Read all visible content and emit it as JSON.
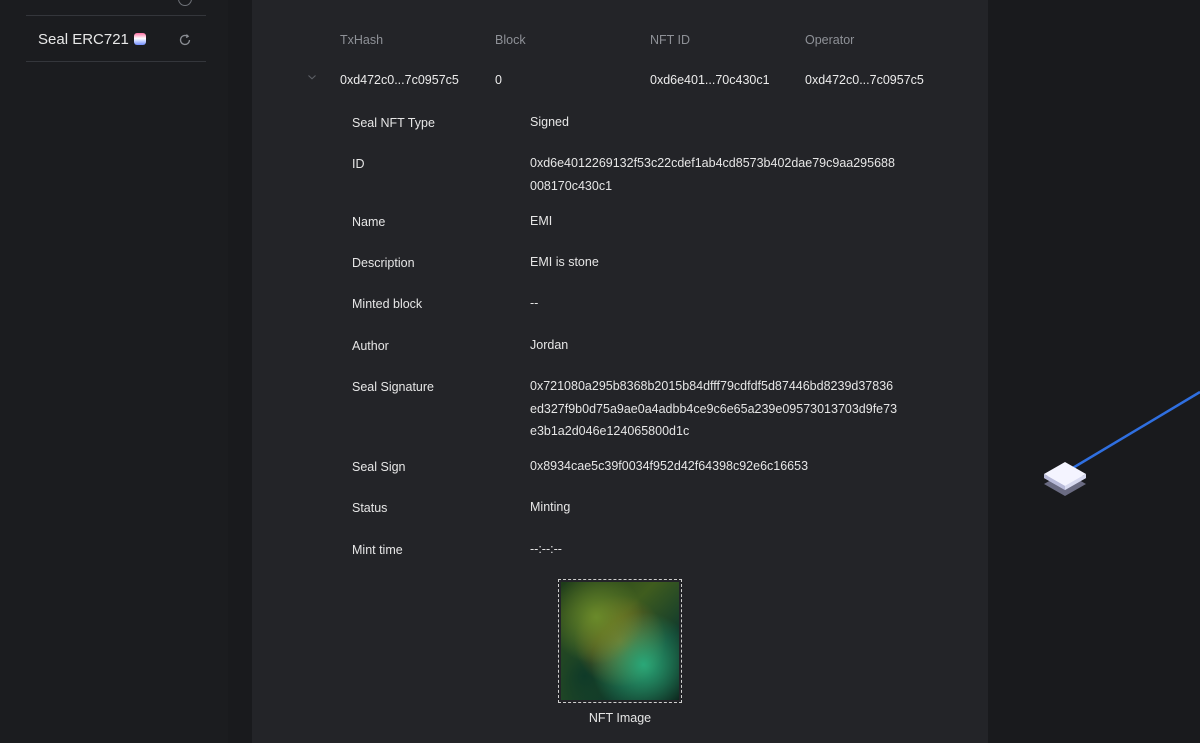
{
  "sidebar": {
    "item": {
      "label": "Seal ERC721",
      "badge_icon": "contract-badge-icon",
      "action_icon": "refresh-icon"
    }
  },
  "table": {
    "headers": [
      "TxHash",
      "Block",
      "NFT ID",
      "Operator"
    ],
    "row": {
      "txhash": "0xd472c0...7c0957c5",
      "block": "0",
      "nft_id": "0xd6e401...70c430c1",
      "operator": "0xd472c0...7c0957c5"
    }
  },
  "details": {
    "seal_nft_type": {
      "label": "Seal NFT Type",
      "value": "Signed"
    },
    "id": {
      "label": "ID",
      "value_line1": "0xd6e4012269132f53c22cdef1ab4cd8573b402dae79c9aa295688",
      "value_line2": "008170c430c1"
    },
    "name": {
      "label": "Name",
      "value": "EMI"
    },
    "description": {
      "label": "Description",
      "value": "EMI is stone"
    },
    "minted_block": {
      "label": "Minted block",
      "value": "--"
    },
    "author": {
      "label": "Author",
      "value": "Jordan"
    },
    "seal_signature": {
      "label": "Seal Signature",
      "value_line1": "0x721080a295b8368b2015b84dfff79cdfdf5d87446bd8239d37836",
      "value_line2": "ed327f9b0d75a9ae0a4adbb4ce9c6e65a239e09573013703d9fe73",
      "value_line3": "e3b1a2d046e124065800d1c"
    },
    "seal_sign": {
      "label": "Seal Sign",
      "value": "0x8934cae5c39f0034f952d42f64398c92e6c16653"
    },
    "status": {
      "label": "Status",
      "value": "Minting"
    },
    "mint_time": {
      "label": "Mint time",
      "value": "--:--:--"
    }
  },
  "nft_image": {
    "caption": "NFT Image"
  },
  "colors": {
    "background": "#191a1d",
    "panel": "#232428",
    "connector": "#2f6fe0"
  }
}
